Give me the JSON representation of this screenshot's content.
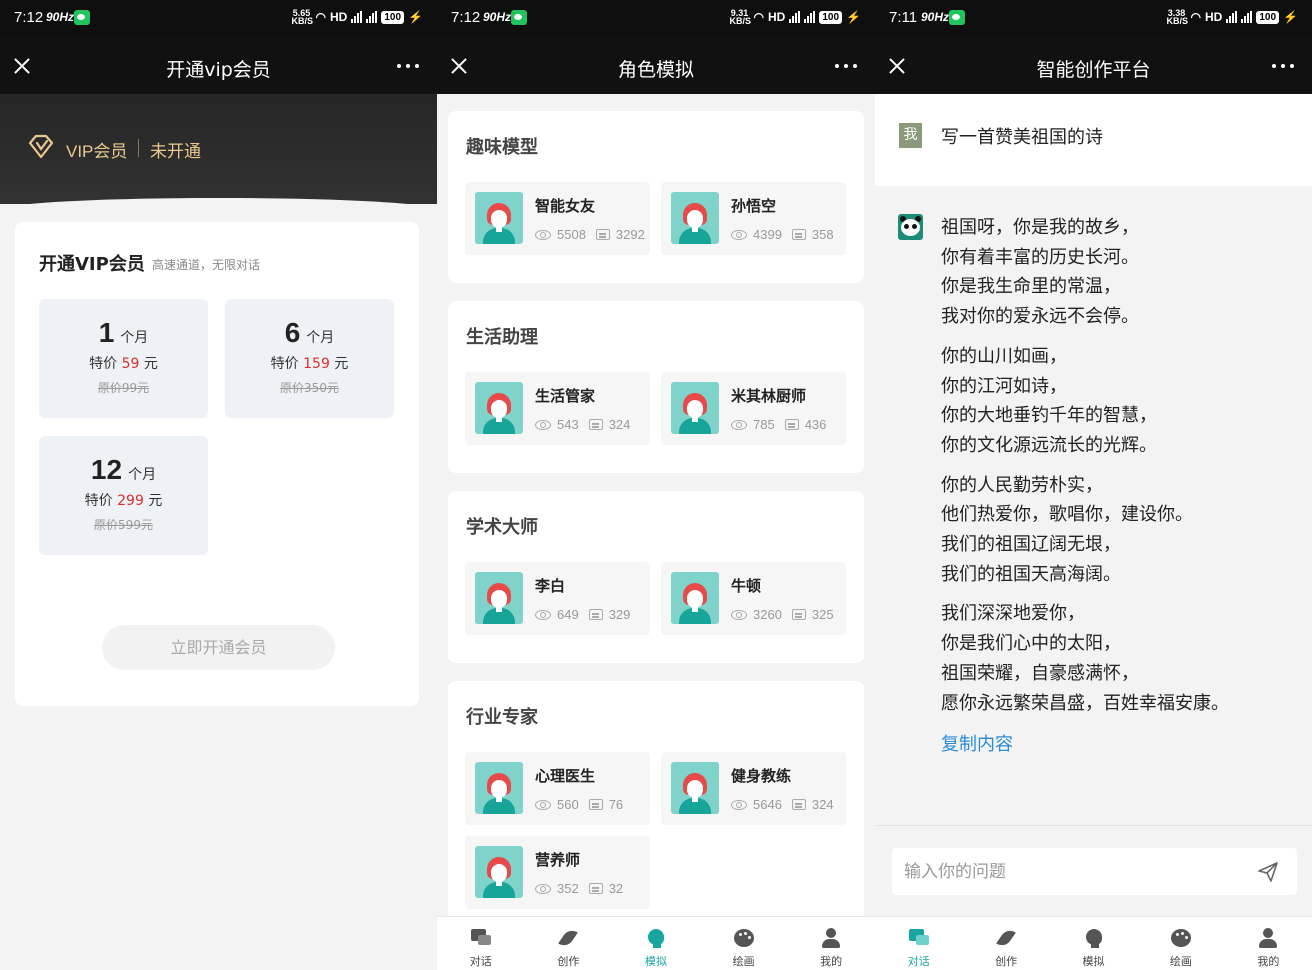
{
  "status_bars": [
    {
      "time": "7:12",
      "hz": "90Hz",
      "speed_top": "5.65",
      "speed_bottom": "KB/S",
      "hd": "HD",
      "battery": "100"
    },
    {
      "time": "7:12",
      "hz": "90Hz",
      "speed_top": "9.31",
      "speed_bottom": "KB/S",
      "hd": "HD",
      "battery": "100"
    },
    {
      "time": "7:11",
      "hz": "90Hz",
      "speed_top": "3.38",
      "speed_bottom": "KB/S",
      "hd": "HD",
      "battery": "100"
    }
  ],
  "vip_page": {
    "title": "开通vip会员",
    "banner": {
      "label": "VIP会员",
      "status": "未开通"
    },
    "card": {
      "title": "开通VIP会员",
      "subtitle": "高速通道，无限对话",
      "plans": [
        {
          "months": "1",
          "unit": "个月",
          "price_prefix": "特价",
          "price": "59",
          "price_unit": "元",
          "original": "原价99元"
        },
        {
          "months": "6",
          "unit": "个月",
          "price_prefix": "特价",
          "price": "159",
          "price_unit": "元",
          "original": "原价350元"
        },
        {
          "months": "12",
          "unit": "个月",
          "price_prefix": "特价",
          "price": "299",
          "price_unit": "元",
          "original": "原价599元"
        }
      ],
      "button": "立即开通会员"
    }
  },
  "role_page": {
    "title": "角色模拟",
    "sections": [
      {
        "title": "趣味模型",
        "roles": [
          {
            "name": "智能女友",
            "views": "5508",
            "chats": "3292"
          },
          {
            "name": "孙悟空",
            "views": "4399",
            "chats": "358"
          }
        ]
      },
      {
        "title": "生活助理",
        "roles": [
          {
            "name": "生活管家",
            "views": "543",
            "chats": "324"
          },
          {
            "name": "米其林厨师",
            "views": "785",
            "chats": "436"
          }
        ]
      },
      {
        "title": "学术大师",
        "roles": [
          {
            "name": "李白",
            "views": "649",
            "chats": "329"
          },
          {
            "name": "牛顿",
            "views": "3260",
            "chats": "325"
          }
        ]
      },
      {
        "title": "行业专家",
        "roles": [
          {
            "name": "心理医生",
            "views": "560",
            "chats": "76"
          },
          {
            "name": "健身教练",
            "views": "5646",
            "chats": "324"
          },
          {
            "name": "营养师",
            "views": "352",
            "chats": "32"
          }
        ]
      }
    ]
  },
  "chat_page": {
    "title": "智能创作平台",
    "user_avatar": "我",
    "question": "写一首赞美祖国的诗",
    "answer_stanzas": [
      [
        "祖国呀，你是我的故乡，",
        "你有着丰富的历史长河。",
        "你是我生命里的常温，",
        "我对你的爱永远不会停。"
      ],
      [
        "你的山川如画，",
        "你的江河如诗，",
        "你的大地垂钓千年的智慧，",
        "你的文化源远流长的光辉。"
      ],
      [
        "你的人民勤劳朴实，",
        "他们热爱你，歌唱你，建设你。",
        "我们的祖国辽阔无垠，",
        "我们的祖国天高海阔。"
      ],
      [
        "我们深深地爱你，",
        "你是我们心中的太阳，",
        "祖国荣耀，自豪感满怀，",
        "愿你永远繁荣昌盛，百姓幸福安康。"
      ]
    ],
    "copy_label": "复制内容",
    "input_placeholder": "输入你的问题",
    "input_value": ""
  },
  "nav": {
    "items": [
      {
        "label": "对话",
        "icon": "chat-icon"
      },
      {
        "label": "创作",
        "icon": "feather-icon"
      },
      {
        "label": "模拟",
        "icon": "head-icon"
      },
      {
        "label": "绘画",
        "icon": "palette-icon"
      },
      {
        "label": "我的",
        "icon": "user-icon"
      }
    ],
    "active_role_page": "模拟",
    "active_chat_page": "对话"
  },
  "colors": {
    "accent": "#19a5a0",
    "vip_gold": "#e9c98d",
    "price_red": "#d9302b",
    "link_blue": "#2a8bd8"
  }
}
